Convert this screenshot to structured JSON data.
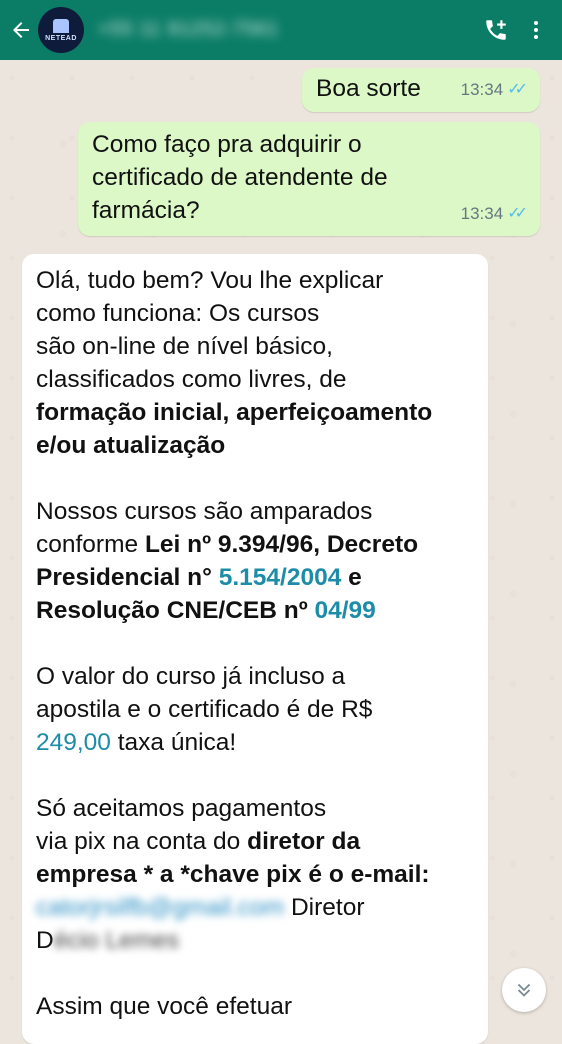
{
  "header": {
    "contact": "+55 11 91252-7561",
    "avatar_label": "NETEAD"
  },
  "messages": {
    "m1": {
      "text": "Boa sorte",
      "time": "13:34"
    },
    "m2": {
      "text": "Como faço pra adquirir o certificado de atendente de farmácia?",
      "time": "13:34"
    },
    "m3": {
      "p1_lines": [
        "Olá, tudo bem? Vou lhe explicar",
        "como funciona: Os cursos",
        "são on-line de nível básico,",
        "classificados como livres, de"
      ],
      "p1_bold": [
        "formação inicial, aperfeiçoamento",
        "e/ou atualização"
      ],
      "p2_l1": "Nossos cursos são amparados",
      "p2_l2a": "conforme ",
      "p2_l2b": "Lei nº 9.394/96, Decreto",
      "p2_l3a": "Presidencial n° ",
      "p2_l3b": "5.154/2004",
      "p2_l3c": " e",
      "p2_l4a": "Resolução CNE/CEB nº ",
      "p2_l4b": "04/99",
      "p3_l1": "O valor do curso já incluso a",
      "p3_l2": "apostila e o certificado é de R$",
      "p3_l3a": "249,00",
      "p3_l3b": " taxa única!",
      "p4_l1": "Só aceitamos pagamentos",
      "p4_l2a": "via pix na conta do ",
      "p4_l2b": "diretor da",
      "p4_l3": "empresa * a *chave pix é o e-mail:",
      "p4_email": "catorjrsilfb@gmail.com",
      "p4_l4b": " Diretor",
      "p4_l5a": "D",
      "p4_l5b": "écio Lemes",
      "p5_l1": "Assim que você efetuar"
    }
  },
  "colors": {
    "header": "#0b7d66",
    "outgoing": "#dcf8c6",
    "incoming": "#ffffff",
    "background": "#ece5dd",
    "read_ticks": "#53bdeb",
    "link": "#1d8ca8"
  },
  "icons": [
    "arrow-left-icon",
    "add-call-icon",
    "more-vert-icon",
    "double-chevron-down-icon"
  ]
}
